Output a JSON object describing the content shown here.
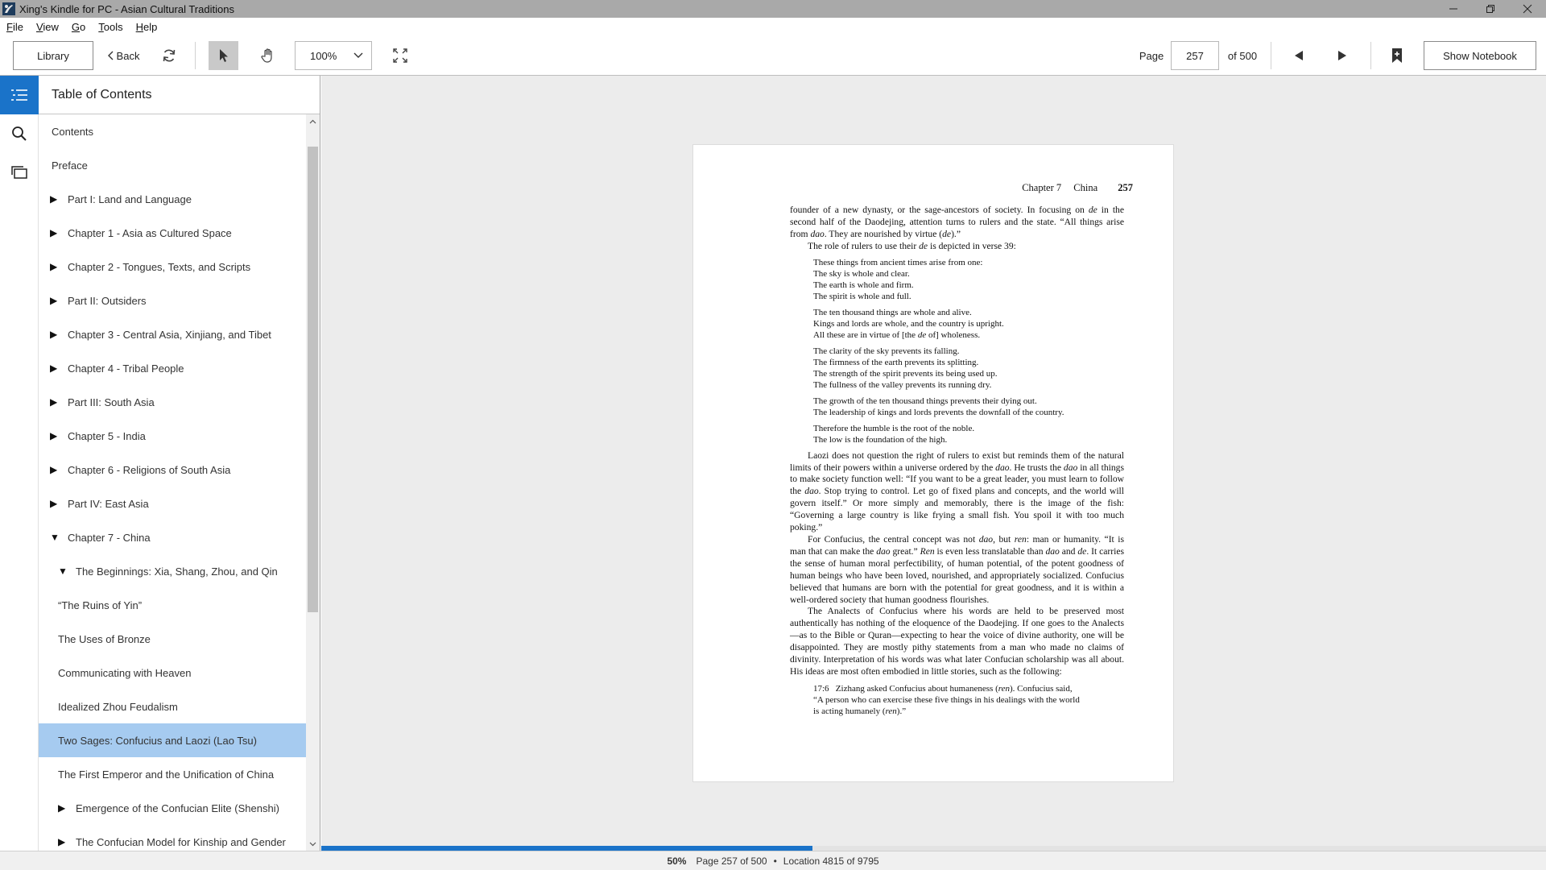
{
  "window": {
    "title": "Xing's Kindle for PC - Asian Cultural Traditions"
  },
  "menu": [
    {
      "label": "File",
      "key": "F",
      "rest": "ile"
    },
    {
      "label": "View",
      "key": "V",
      "rest": "iew"
    },
    {
      "label": "Go",
      "key": "G",
      "rest": "o"
    },
    {
      "label": "Tools",
      "key": "T",
      "rest": "ools"
    },
    {
      "label": "Help",
      "key": "H",
      "rest": "elp"
    }
  ],
  "toolbar": {
    "library_label": "Library",
    "back_label": "Back",
    "zoom_value": "100%",
    "page_label": "Page",
    "page_value": "257",
    "page_total": "of 500",
    "notebook_label": "Show Notebook"
  },
  "toc": {
    "title": "Table of Contents",
    "items": [
      {
        "label": "Contents",
        "level": "l0",
        "arrow": ""
      },
      {
        "label": "Preface",
        "level": "l0",
        "arrow": ""
      },
      {
        "label": "Part I: Land and Language",
        "level": "l0e",
        "arrow": "collapsed"
      },
      {
        "label": "Chapter 1 - Asia as Cultured Space",
        "level": "l0e",
        "arrow": "collapsed"
      },
      {
        "label": "Chapter 2 - Tongues, Texts, and Scripts",
        "level": "l0e",
        "arrow": "collapsed"
      },
      {
        "label": "Part II: Outsiders",
        "level": "l0e",
        "arrow": "collapsed"
      },
      {
        "label": "Chapter 3 - Central Asia, Xinjiang, and Tibet",
        "level": "l0e",
        "arrow": "collapsed"
      },
      {
        "label": "Chapter 4 - Tribal People",
        "level": "l0e",
        "arrow": "collapsed"
      },
      {
        "label": "Part III: South Asia",
        "level": "l0e",
        "arrow": "collapsed"
      },
      {
        "label": "Chapter 5 - India",
        "level": "l0e",
        "arrow": "collapsed"
      },
      {
        "label": "Chapter 6 - Religions of South Asia",
        "level": "l0e",
        "arrow": "collapsed"
      },
      {
        "label": "Part IV: East Asia",
        "level": "l0e",
        "arrow": "collapsed"
      },
      {
        "label": "Chapter 7 - China",
        "level": "l0e",
        "arrow": "expanded"
      },
      {
        "label": "The Beginnings: Xia, Shang, Zhou, and Qin",
        "level": "l1e",
        "arrow": "expanded"
      },
      {
        "label": "“The Ruins of Yin”",
        "level": "l1",
        "arrow": ""
      },
      {
        "label": "The Uses of Bronze",
        "level": "l1",
        "arrow": ""
      },
      {
        "label": "Communicating with Heaven",
        "level": "l1",
        "arrow": ""
      },
      {
        "label": "Idealized Zhou Feudalism",
        "level": "l1",
        "arrow": ""
      },
      {
        "label": "Two Sages: Confucius and Laozi (Lao Tsu)",
        "level": "l1",
        "arrow": "",
        "selected": true
      },
      {
        "label": "The First Emperor and the Unification of China",
        "level": "l1",
        "arrow": ""
      },
      {
        "label": "Emergence of the Confucian Elite (Shenshi)",
        "level": "l1e",
        "arrow": "collapsed"
      },
      {
        "label": "The Confucian Model for Kinship and Gender",
        "level": "l1e",
        "arrow": "collapsed"
      }
    ]
  },
  "page": {
    "running_head_chapter": "Chapter 7",
    "running_head_section": "China",
    "running_head_number": "257"
  },
  "progress": {
    "fraction": 0.401
  },
  "status": {
    "percent": "50%",
    "page": "Page 257 of 500",
    "separator": "•",
    "location": "Location 4815 of 9795"
  },
  "colors": {
    "accent": "#1a73c9",
    "selected": "#a6cbf0"
  }
}
